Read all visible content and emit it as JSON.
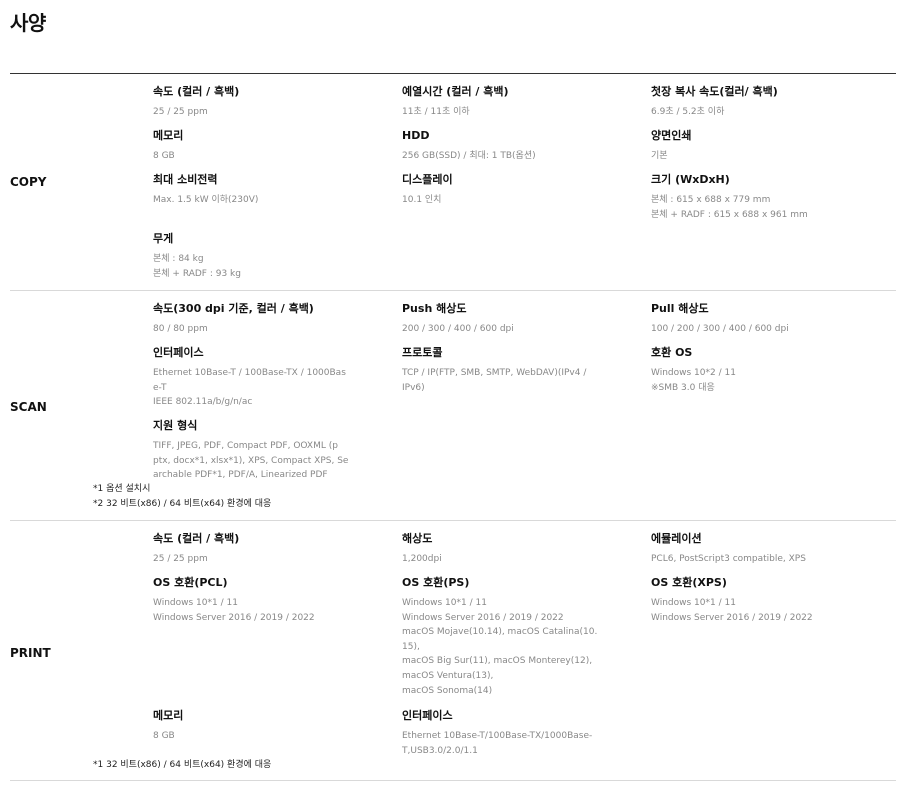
{
  "page": {
    "title": "사양"
  },
  "sections": {
    "copy": {
      "label": "COPY",
      "items": [
        {
          "name": "속도 (컬러 / 흑백)",
          "lines": [
            "25 / 25 ppm"
          ]
        },
        {
          "name": "예열시간 (컬러 / 흑백)",
          "lines": [
            "11초 / 11초 이하"
          ]
        },
        {
          "name": "첫장 복사 속도(컬러/ 흑백)",
          "lines": [
            "6.9초 / 5.2초 이하"
          ]
        },
        {
          "name": "메모리",
          "lines": [
            "8 GB"
          ]
        },
        {
          "name": "HDD",
          "lines": [
            "256 GB(SSD) / 최대: 1 TB(옵션)"
          ]
        },
        {
          "name": "양면인쇄",
          "lines": [
            "기본"
          ]
        },
        {
          "name": "최대 소비전력",
          "lines": [
            "Max. 1.5 kW 이하(230V)"
          ]
        },
        {
          "name": "디스플레이",
          "lines": [
            "10.1 인치"
          ]
        },
        {
          "name": "크기 (WxDxH)",
          "lines": [
            "본체 : 615 x 688 x 779 mm",
            "본체 + RADF : 615 x 688 x 961 mm"
          ]
        },
        {
          "name": "무게",
          "lines": [
            "본체 : 84 kg",
            "본체 + RADF : 93 kg"
          ]
        }
      ]
    },
    "scan": {
      "label": "SCAN",
      "items": [
        {
          "name": "속도(300 dpi 기준, 컬러 / 흑백)",
          "lines": [
            "80 / 80 ppm"
          ]
        },
        {
          "name": "Push 해상도",
          "lines": [
            "200 / 300 / 400 / 600 dpi"
          ]
        },
        {
          "name": "Pull 해상도",
          "lines": [
            "100 / 200 / 300 / 400 / 600 dpi"
          ]
        },
        {
          "name": "인터페이스",
          "lines": [
            "Ethernet 10Base-T / 100Base-TX / 1000Bas",
            "e-T",
            "IEEE 802.11a/b/g/n/ac"
          ]
        },
        {
          "name": "프로토콜",
          "lines": [
            "TCP / IP(FTP, SMB, SMTP, WebDAV)(IPv4 /",
            "IPv6)"
          ]
        },
        {
          "name": "호환 OS",
          "lines": [
            "Windows 10*2 / 11",
            "※SMB 3.0 대응"
          ]
        },
        {
          "name": "지원 형식",
          "lines": [
            "TIFF, JPEG, PDF, Compact PDF, OOXML (p",
            "ptx, docx*1, xlsx*1), XPS, Compact XPS, Se",
            "archable PDF*1, PDF/A, Linearized PDF"
          ]
        }
      ],
      "notes": [
        "*1 옵션 설치시",
        "*2 32 비트(x86) / 64 비트(x64) 환경에 대응"
      ]
    },
    "print": {
      "label": "PRINT",
      "items": [
        {
          "name": "속도 (컬러 / 흑백)",
          "lines": [
            "25 / 25 ppm"
          ]
        },
        {
          "name": "해상도",
          "lines": [
            "1,200dpi"
          ]
        },
        {
          "name": "에뮬레이션",
          "lines": [
            "PCL6, PostScript3 compatible, XPS"
          ]
        },
        {
          "name": "OS 호환(PCL)",
          "lines": [
            "Windows 10*1 / 11",
            "Windows Server 2016 / 2019 / 2022"
          ]
        },
        {
          "name": "OS 호환(PS)",
          "lines": [
            "Windows 10*1 / 11",
            "Windows Server 2016 / 2019 / 2022",
            "macOS Mojave(10.14), macOS Catalina(10.",
            "15),",
            "macOS Big Sur(11), macOS Monterey(12),",
            "macOS Ventura(13),",
            "macOS Sonoma(14)"
          ]
        },
        {
          "name": "OS 호환(XPS)",
          "lines": [
            "Windows 10*1 / 11",
            "Windows Server 2016 / 2019 / 2022"
          ]
        },
        {
          "name": "메모리",
          "lines": [
            "8 GB"
          ]
        },
        {
          "name": "인터페이스",
          "lines": [
            "Ethernet 10Base-T/100Base-TX/1000Base-",
            "T,USB3.0/2.0/1.1"
          ]
        }
      ],
      "notes": [
        "*1 32 비트(x86) / 64 비트(x64) 환경에 대응"
      ]
    }
  }
}
